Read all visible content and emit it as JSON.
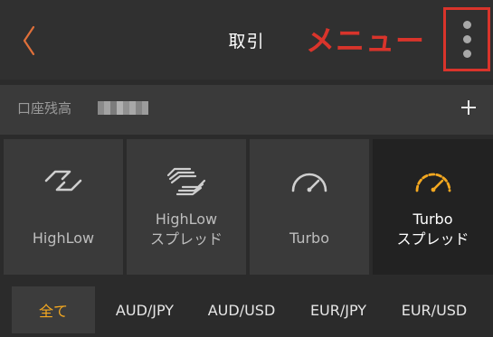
{
  "colors": {
    "accent": "#f4a820",
    "back_arrow": "#e0703a",
    "annotation": "#d9342b",
    "header_bg": "#303030",
    "tile_bg": "#3a3a3a",
    "tile_selected_bg": "#222222"
  },
  "header": {
    "title": "取引",
    "back_icon": "chevron-left-icon",
    "menu_icon": "more-vertical-icon",
    "annotation": "メニュー"
  },
  "balance": {
    "label": "口座残高",
    "add_icon": "plus-icon"
  },
  "trade_types": [
    {
      "line1": "HighLow",
      "line2": "",
      "icon": "highlow-icon",
      "selected": false
    },
    {
      "line1": "HighLow",
      "line2": "スプレッド",
      "icon": "highlow-spread-icon",
      "selected": false
    },
    {
      "line1": "Turbo",
      "line2": "",
      "icon": "speedometer-icon",
      "selected": false
    },
    {
      "line1": "Turbo",
      "line2": "スプレッド",
      "icon": "speedometer-icon",
      "selected": true
    }
  ],
  "tabs": [
    {
      "label": "全て",
      "active": true
    },
    {
      "label": "AUD/JPY",
      "active": false
    },
    {
      "label": "AUD/USD",
      "active": false
    },
    {
      "label": "EUR/JPY",
      "active": false
    },
    {
      "label": "EUR/USD",
      "active": false
    }
  ]
}
